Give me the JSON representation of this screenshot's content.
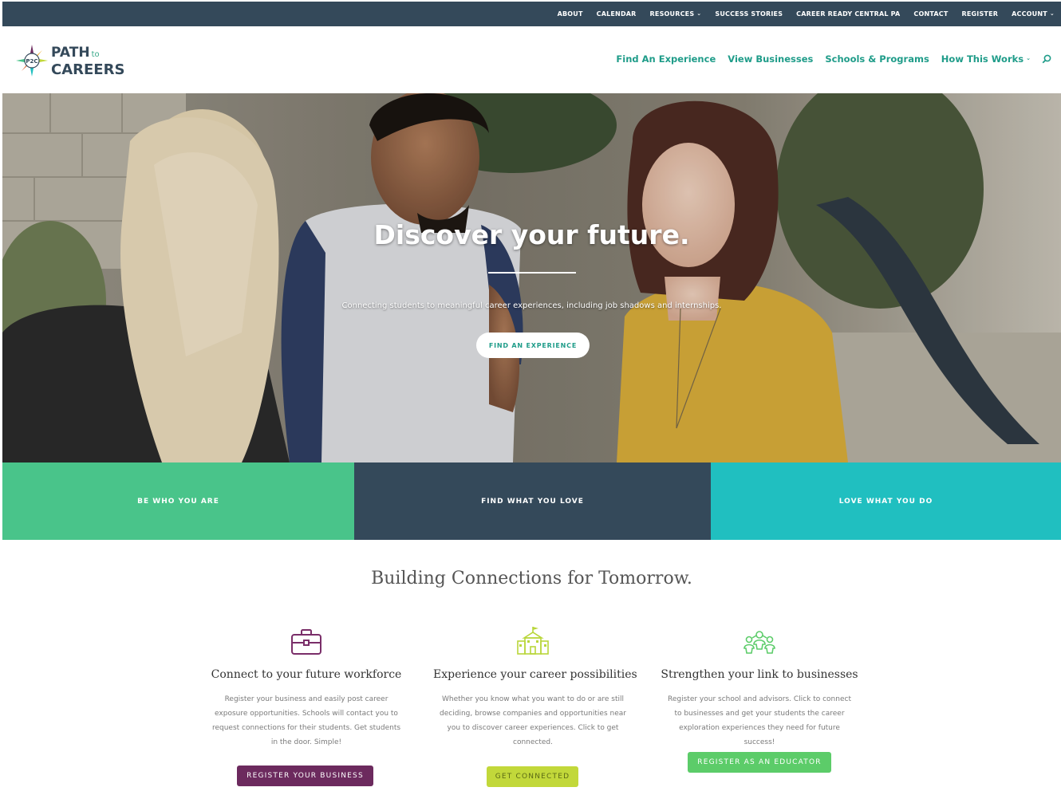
{
  "topbar": {
    "items": [
      {
        "label": "ABOUT",
        "dropdown": false
      },
      {
        "label": "CALENDAR",
        "dropdown": false
      },
      {
        "label": "RESOURCES",
        "dropdown": true
      },
      {
        "label": "SUCCESS STORIES",
        "dropdown": false
      },
      {
        "label": "CAREER READY CENTRAL PA",
        "dropdown": false
      },
      {
        "label": "CONTACT",
        "dropdown": false
      },
      {
        "label": "REGISTER",
        "dropdown": false
      },
      {
        "label": "ACCOUNT",
        "dropdown": true
      }
    ]
  },
  "logo": {
    "line1": "PATH",
    "small": "to",
    "line2": "CAREERS",
    "badge": "P2C"
  },
  "mainnav": {
    "items": [
      {
        "label": "Find An Experience"
      },
      {
        "label": "View Businesses"
      },
      {
        "label": "Schools & Programs"
      },
      {
        "label": "How This Works"
      }
    ],
    "search_icon": "search-icon"
  },
  "hero": {
    "title": "Discover your future.",
    "subtitle": "Connecting students to meaningful career experiences, including job shadows and internships.",
    "button": "FIND AN EXPERIENCE"
  },
  "bands": [
    {
      "label": "BE WHO YOU ARE",
      "color": "#49c48a"
    },
    {
      "label": "FIND WHAT YOU LOVE",
      "color": "#34495a"
    },
    {
      "label": "LOVE WHAT YOU DO",
      "color": "#20bfc0"
    }
  ],
  "tagline": "Building Connections for Tomorrow.",
  "columns": [
    {
      "icon": "briefcase-icon",
      "title": "Connect to your future workforce",
      "text": "Register your business and easily post career exposure opportunities. Schools will contact you to request connections for their students. Get students in the door. Simple!",
      "button": "REGISTER YOUR BUSINESS",
      "color": "#6c2a5e"
    },
    {
      "icon": "school-icon",
      "title": "Experience your career possibilities",
      "text": "Whether you know what you want to do or are still deciding, browse companies and opportunities near you to discover career experiences. Click to get connected.",
      "button": "GET CONNECTED",
      "color": "#c2d83a"
    },
    {
      "icon": "people-network-icon",
      "title": "Strengthen your link to businesses",
      "text": "Register your school and advisors. Click to connect to businesses and get your students the career exploration experiences they need for future success!",
      "button": "REGISTER AS AN EDUCATOR",
      "color": "#5ccc69"
    }
  ],
  "colors": {
    "brand_dark": "#34495a",
    "brand_teal": "#1f9c89"
  }
}
